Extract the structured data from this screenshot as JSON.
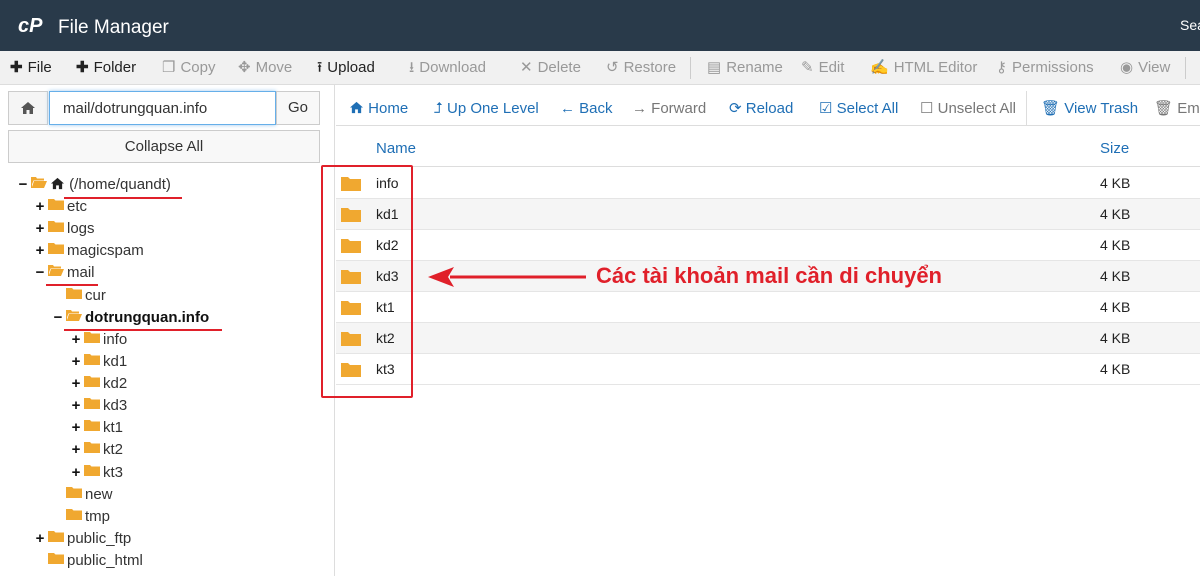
{
  "app": {
    "title": "File Manager",
    "search_label": "Sea"
  },
  "toolbar": {
    "file": "File",
    "folder": "Folder",
    "copy": "Copy",
    "move": "Move",
    "upload": "Upload",
    "download": "Download",
    "delete": "Delete",
    "restore": "Restore",
    "rename": "Rename",
    "edit": "Edit",
    "html_editor": "HTML Editor",
    "permissions": "Permissions",
    "view": "View"
  },
  "path_bar": {
    "value": "mail/dotrungquan.info",
    "go": "Go"
  },
  "collapse_all": "Collapse All",
  "tree": {
    "root": "(/home/quandt)",
    "etc": "etc",
    "logs": "logs",
    "magicspam": "magicspam",
    "mail": "mail",
    "cur": "cur",
    "domain": "dotrungquan.info",
    "info": "info",
    "kd1": "kd1",
    "kd2": "kd2",
    "kd3": "kd3",
    "kt1": "kt1",
    "kt2": "kt2",
    "kt3": "kt3",
    "new": "new",
    "tmp": "tmp",
    "public_ftp": "public_ftp",
    "public_html": "public_html"
  },
  "nav": {
    "home": "Home",
    "up": "Up One Level",
    "back": "Back",
    "forward": "Forward",
    "reload": "Reload",
    "select_all": "Select All",
    "unselect_all": "Unselect All",
    "view_trash": "View Trash",
    "empty": "Emp"
  },
  "table": {
    "columns": {
      "name": "Name",
      "size": "Size"
    },
    "rows": [
      {
        "name": "info",
        "size": "4 KB"
      },
      {
        "name": "kd1",
        "size": "4 KB"
      },
      {
        "name": "kd2",
        "size": "4 KB"
      },
      {
        "name": "kd3",
        "size": "4 KB"
      },
      {
        "name": "kt1",
        "size": "4 KB"
      },
      {
        "name": "kt2",
        "size": "4 KB"
      },
      {
        "name": "kt3",
        "size": "4 KB"
      }
    ]
  },
  "annotation": "Các tài khoản mail cần di chuyển",
  "colors": {
    "topbar": "#293a4a",
    "link_blue": "#1f6fb5",
    "folder": "#f0a830",
    "annotation_red": "#e0202a"
  }
}
